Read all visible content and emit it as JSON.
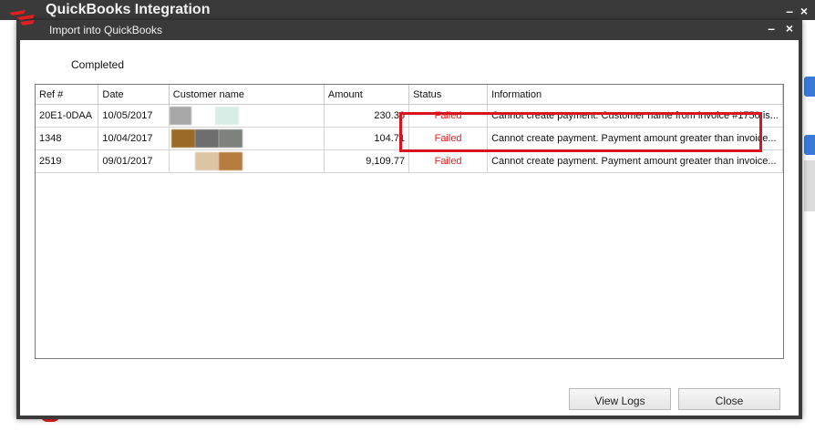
{
  "parent_window": {
    "title": "QuickBooks Integration",
    "minimize": "–",
    "close": "×"
  },
  "dialog": {
    "title": "Import into QuickBooks",
    "minimize": "–",
    "close": "×",
    "status_text": "Completed",
    "columns": [
      "Ref #",
      "Date",
      "Customer name",
      "Amount",
      "Status",
      "Information"
    ],
    "rows": [
      {
        "ref": "20E1-0DAA",
        "date": "10/05/2017",
        "amount": "230.36",
        "status": "Failed",
        "information": "Cannot create payment. Customer name from invoice #1750 is..."
      },
      {
        "ref": "1348",
        "date": "10/04/2017",
        "amount": "104.71",
        "status": "Failed",
        "information": "Cannot create payment. Payment amount greater than invoice..."
      },
      {
        "ref": "2519",
        "date": "09/01/2017",
        "amount": "9,109.77",
        "status": "Failed",
        "information": "Cannot create payment. Payment amount greater than invoice..."
      }
    ],
    "buttons": {
      "view_logs": "View Logs",
      "close": "Close"
    }
  },
  "colors": {
    "titlebar": "#3a3a3a",
    "failed": "#e02020",
    "highlight": "#d9141e",
    "accent": "#3b78d8"
  }
}
